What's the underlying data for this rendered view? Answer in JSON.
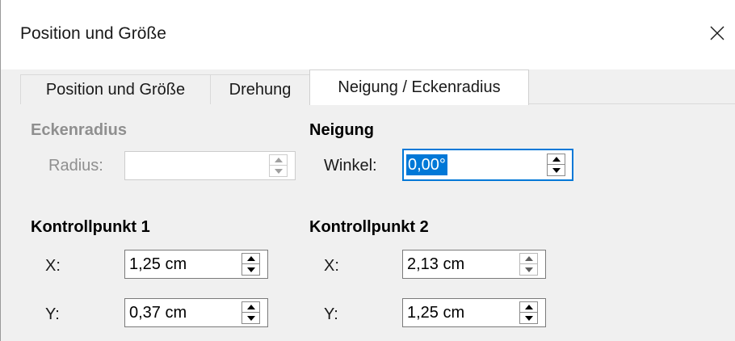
{
  "window": {
    "title": "Position und Größe"
  },
  "tabs": [
    {
      "label": "Position und Größe",
      "active": false
    },
    {
      "label": "Drehung",
      "active": false
    },
    {
      "label": "Neigung / Eckenradius",
      "active": true
    }
  ],
  "eckenradius": {
    "title": "Eckenradius",
    "radius_label": "Radius:",
    "radius_value": "",
    "enabled": false
  },
  "neigung": {
    "title": "Neigung",
    "winkel_label": "Winkel:",
    "winkel_value": "0,00°"
  },
  "kontrollpunkt1": {
    "title": "Kontrollpunkt 1",
    "x_label": "X:",
    "x_value": "1,25 cm",
    "y_label": "Y:",
    "y_value": "0,37 cm"
  },
  "kontrollpunkt2": {
    "title": "Kontrollpunkt 2",
    "x_label": "X:",
    "x_value": "2,13 cm",
    "y_label": "Y:",
    "y_value": "1,25 cm"
  },
  "colors": {
    "accent": "#0078d7",
    "panel": "#f0f0f0",
    "disabled_text": "#8f8f8f"
  },
  "icons": {
    "close": "close-icon",
    "spin_up": "chevron-up-icon",
    "spin_down": "chevron-down-icon"
  }
}
